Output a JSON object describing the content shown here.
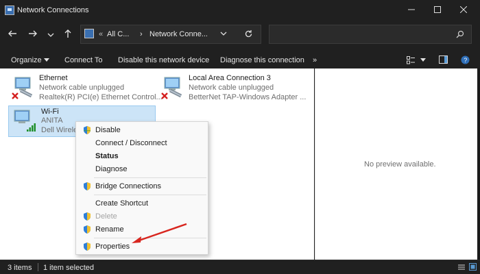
{
  "window": {
    "title": "Network Connections"
  },
  "address": {
    "chevron": "«",
    "crumb1": "All C...",
    "separator": "›",
    "crumb2": "Network Conne..."
  },
  "toolbar": {
    "organize": "Organize",
    "connect_to": "Connect To",
    "disable": "Disable this network device",
    "diagnose": "Diagnose this connection",
    "more": "»"
  },
  "connections": [
    {
      "name": "Ethernet",
      "line1": "Network cable unplugged",
      "line2": "Realtek(R) PCI(e) Ethernet Control...",
      "status_icon": "red-x-icon"
    },
    {
      "name": "Local Area Connection 3",
      "line1": "Network cable unplugged",
      "line2": "BetterNet TAP-Windows Adapter ...",
      "status_icon": "red-x-icon"
    },
    {
      "name": "Wi-Fi",
      "line1": "ANITA",
      "line2": "Dell Wirele",
      "status_icon": "signal-bars-icon",
      "selected": true
    }
  ],
  "context_menu": {
    "items": [
      {
        "label": "Disable",
        "shield": true
      },
      {
        "label": "Connect / Disconnect",
        "shield": false
      },
      {
        "label": "Status",
        "bold": true
      },
      {
        "label": "Diagnose",
        "shield": false
      },
      {
        "label": "Bridge Connections",
        "shield": true
      },
      {
        "label": "Create Shortcut",
        "shield": false
      },
      {
        "label": "Delete",
        "shield": true,
        "disabled": true
      },
      {
        "label": "Rename",
        "shield": true
      },
      {
        "label": "Properties",
        "shield": true
      }
    ]
  },
  "preview": {
    "text": "No preview available."
  },
  "statusbar": {
    "items_count": "3 items",
    "selected_count": "1 item selected"
  },
  "colors": {
    "selection": "#cce4f7",
    "arrow": "#d8261f",
    "chrome": "#202020"
  }
}
